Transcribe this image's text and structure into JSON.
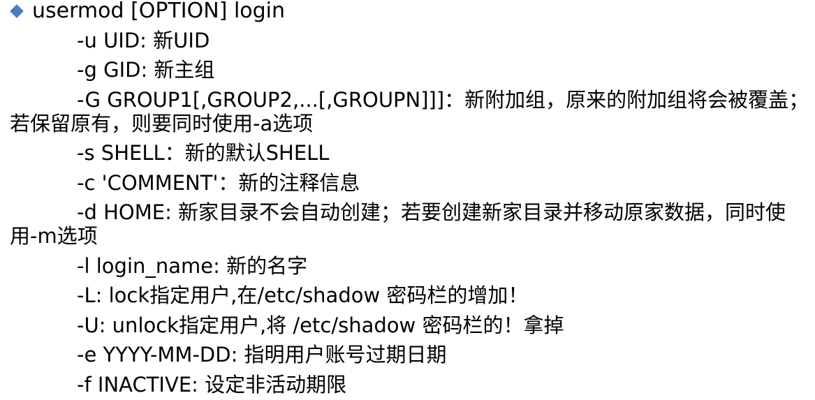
{
  "heading": {
    "bullet_icon": "diamond-bullet-icon",
    "bullet_color": "#4a7ec0",
    "text": "usermod [OPTION] login"
  },
  "options": [
    "-u UID: 新UID",
    "-g GID: 新主组",
    "-G GROUP1[,GROUP2,...[,GROUPN]]]：新附加组，原来的附加组将会被覆盖；若保留原有，则要同时使用-a选项",
    "-s SHELL：新的默认SHELL",
    "-c 'COMMENT'：新的注释信息",
    "-d HOME: 新家目录不会自动创建；若要创建新家目录并移动原家数据，同时使用-m选项",
    "-l login_name: 新的名字",
    "-L: lock指定用户,在/etc/shadow 密码栏的增加！",
    "-U: unlock指定用户,将 /etc/shadow 密码栏的！拿掉",
    "-e YYYY-MM-DD: 指明用户账号过期日期",
    "-f INACTIVE: 设定非活动期限"
  ]
}
